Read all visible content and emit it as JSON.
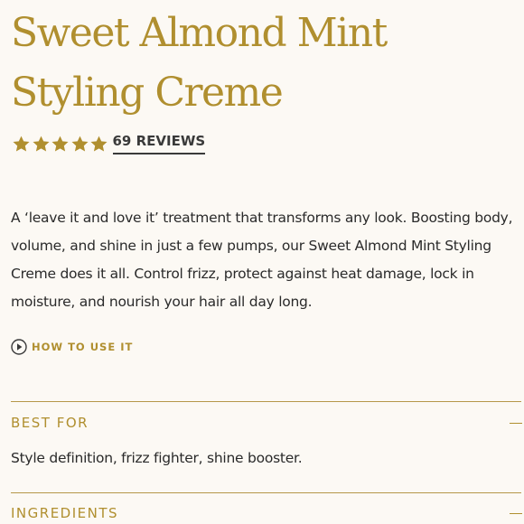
{
  "product": {
    "title": "Sweet Almond Mint Styling Creme"
  },
  "rating": {
    "stars": 5,
    "max_stars": 5,
    "star_icon": "star-icon",
    "reviews_label": "69 REVIEWS"
  },
  "description": "A ‘leave it and love it’ treatment that transforms any look. Boosting body, volume, and shine in just a few pumps, our Sweet Almond Mint Styling Creme does it all. Control frizz, protect against heat damage, lock in moisture, and nourish your hair all day long.",
  "how_to": {
    "icon": "play-circle-icon",
    "label": "HOW TO USE IT"
  },
  "accordion": [
    {
      "title": "BEST FOR",
      "expanded": true,
      "toggle_icon": "minus-icon",
      "body": "Style definition, frizz fighter, shine booster."
    },
    {
      "title": "INGREDIENTS",
      "expanded": true,
      "toggle_icon": "minus-icon"
    }
  ],
  "colors": {
    "accent_gold": "#b08f2f",
    "text": "#2a2a2a",
    "background": "#fcf9f4"
  }
}
